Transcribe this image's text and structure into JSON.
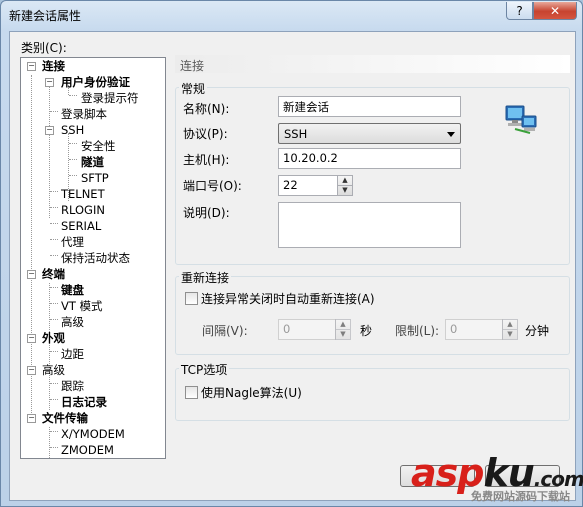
{
  "window": {
    "title": "新建会话属性",
    "help": "?",
    "close": "✕"
  },
  "category_label": "类别(C):",
  "tree": [
    {
      "label": "连接",
      "bold": true
    },
    {
      "label": "用户身份验证",
      "bold": true
    },
    {
      "label": "登录提示符",
      "bold": false
    },
    {
      "label": "登录脚本",
      "bold": false
    },
    {
      "label": "SSH",
      "bold": false
    },
    {
      "label": "安全性",
      "bold": false
    },
    {
      "label": "隧道",
      "bold": true
    },
    {
      "label": "SFTP",
      "bold": false
    },
    {
      "label": "TELNET",
      "bold": false
    },
    {
      "label": "RLOGIN",
      "bold": false
    },
    {
      "label": "SERIAL",
      "bold": false
    },
    {
      "label": "代理",
      "bold": false
    },
    {
      "label": "保持活动状态",
      "bold": false
    },
    {
      "label": "终端",
      "bold": true
    },
    {
      "label": "键盘",
      "bold": true
    },
    {
      "label": "VT 模式",
      "bold": false
    },
    {
      "label": "高级",
      "bold": false
    },
    {
      "label": "外观",
      "bold": true
    },
    {
      "label": "边距",
      "bold": false
    },
    {
      "label": "高级",
      "bold": false
    },
    {
      "label": "跟踪",
      "bold": false
    },
    {
      "label": "日志记录",
      "bold": true
    },
    {
      "label": "文件传输",
      "bold": true
    },
    {
      "label": "X/YMODEM",
      "bold": false
    },
    {
      "label": "ZMODEM",
      "bold": false
    }
  ],
  "panel": {
    "header": "连接",
    "general": {
      "title": "常规",
      "name_label": "名称(N):",
      "name_value": "新建会话",
      "protocol_label": "协议(P):",
      "protocol_value": "SSH",
      "host_label": "主机(H):",
      "host_value": "10.20.0.2",
      "port_label": "端口号(O):",
      "port_value": "22",
      "desc_label": "说明(D):",
      "desc_value": ""
    },
    "reconnect": {
      "title": "重新连接",
      "checkbox_label": "连接异常关闭时自动重新连接(A)",
      "interval_label": "间隔(V):",
      "interval_value": "0",
      "interval_unit": "秒",
      "limit_label": "限制(L):",
      "limit_value": "0",
      "limit_unit": "分钟"
    },
    "tcp": {
      "title": "TCP选项",
      "nagle_label": "使用Nagle算法(U)"
    }
  },
  "watermark": {
    "brand_a": "asp",
    "brand_b": "ku",
    "domain": ".com",
    "subtitle": "免费网站源码下载站"
  }
}
